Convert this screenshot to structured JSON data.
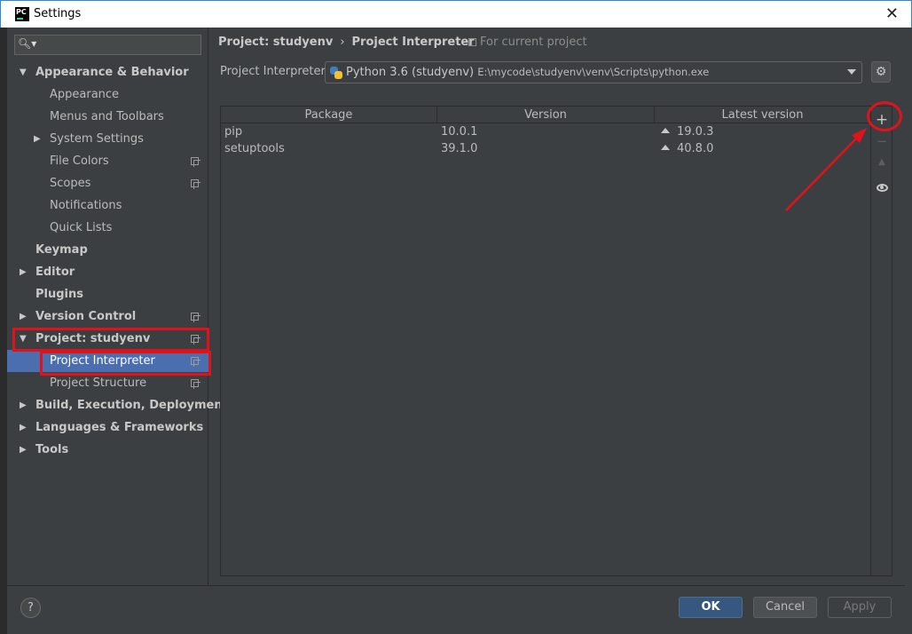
{
  "window": {
    "title": "Settings",
    "app_icon_text": "PC"
  },
  "search": {
    "placeholder": ""
  },
  "sidebar": {
    "items": [
      {
        "label": "Appearance & Behavior",
        "level": 0,
        "expanded": true,
        "bold": true
      },
      {
        "label": "Appearance",
        "level": 1
      },
      {
        "label": "Menus and Toolbars",
        "level": 1
      },
      {
        "label": "System Settings",
        "level": 1,
        "collapsed": true
      },
      {
        "label": "File Colors",
        "level": 1,
        "project_icon": true
      },
      {
        "label": "Scopes",
        "level": 1,
        "project_icon": true
      },
      {
        "label": "Notifications",
        "level": 1
      },
      {
        "label": "Quick Lists",
        "level": 1
      },
      {
        "label": "Keymap",
        "level": 0,
        "bold": true
      },
      {
        "label": "Editor",
        "level": 0,
        "bold": true,
        "collapsed": true
      },
      {
        "label": "Plugins",
        "level": 0,
        "bold": true
      },
      {
        "label": "Version Control",
        "level": 0,
        "bold": true,
        "collapsed": true,
        "project_icon": true
      },
      {
        "label": "Project: studyenv",
        "level": 0,
        "bold": true,
        "expanded": true,
        "project_icon": true
      },
      {
        "label": "Project Interpreter",
        "level": 1,
        "selected": true,
        "project_icon": true
      },
      {
        "label": "Project Structure",
        "level": 1,
        "project_icon": true
      },
      {
        "label": "Build, Execution, Deployment",
        "level": 0,
        "bold": true,
        "collapsed": true
      },
      {
        "label": "Languages & Frameworks",
        "level": 0,
        "bold": true,
        "collapsed": true
      },
      {
        "label": "Tools",
        "level": 0,
        "bold": true,
        "collapsed": true
      }
    ]
  },
  "main": {
    "breadcrumb": {
      "parent": "Project: studyenv",
      "separator": "›",
      "current": "Project Interpreter"
    },
    "scope_label": "For current project",
    "interpreter_label": "Project Interpreter:",
    "interpreter_name": "Python 3.6 (studyenv)",
    "interpreter_path": "E:\\mycode\\studyenv\\venv\\Scripts\\python.exe",
    "table": {
      "headers": [
        "Package",
        "Version",
        "Latest version"
      ],
      "rows": [
        {
          "package": "pip",
          "version": "10.0.1",
          "latest": "19.0.3"
        },
        {
          "package": "setuptools",
          "version": "39.1.0",
          "latest": "40.8.0"
        }
      ]
    },
    "tools": {
      "add": "+",
      "remove": "−",
      "upgrade": "▲"
    }
  },
  "footer": {
    "help": "?",
    "ok": "OK",
    "cancel": "Cancel",
    "apply": "Apply"
  },
  "colors": {
    "background": "#3c3f41",
    "selection": "#4b6eaf",
    "annotation": "#e0121b",
    "ok_button": "#365880"
  }
}
